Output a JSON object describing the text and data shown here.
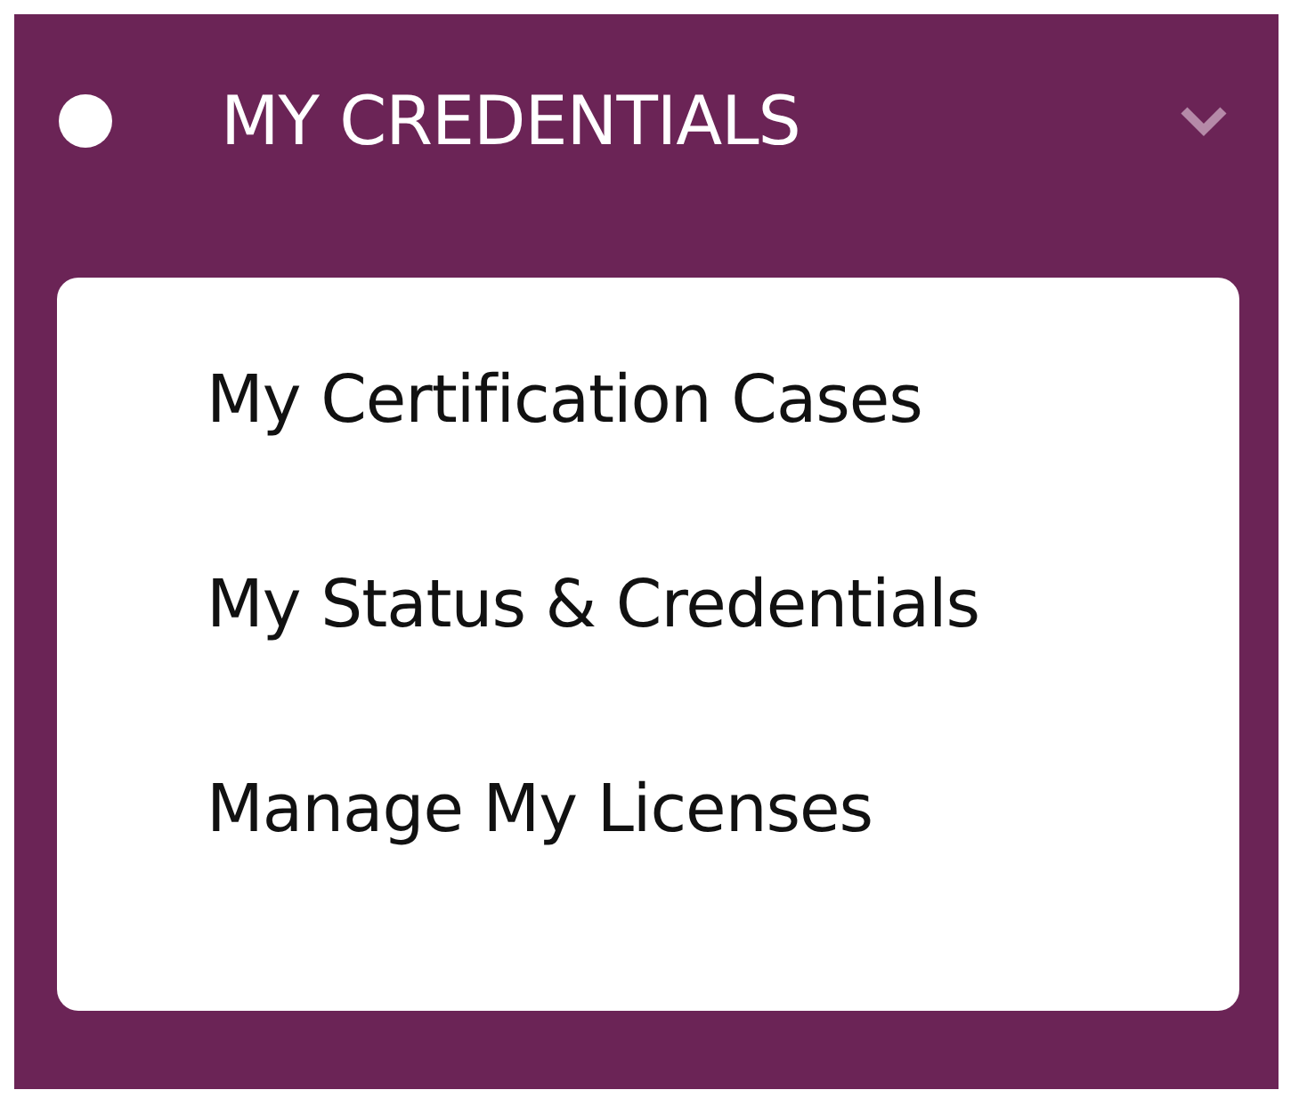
{
  "menu": {
    "title": "MY CREDENTIALS",
    "expanded": true,
    "items": [
      {
        "label": "My Certification Cases"
      },
      {
        "label": "My Status & Credentials"
      },
      {
        "label": "Manage My Licenses"
      }
    ]
  }
}
